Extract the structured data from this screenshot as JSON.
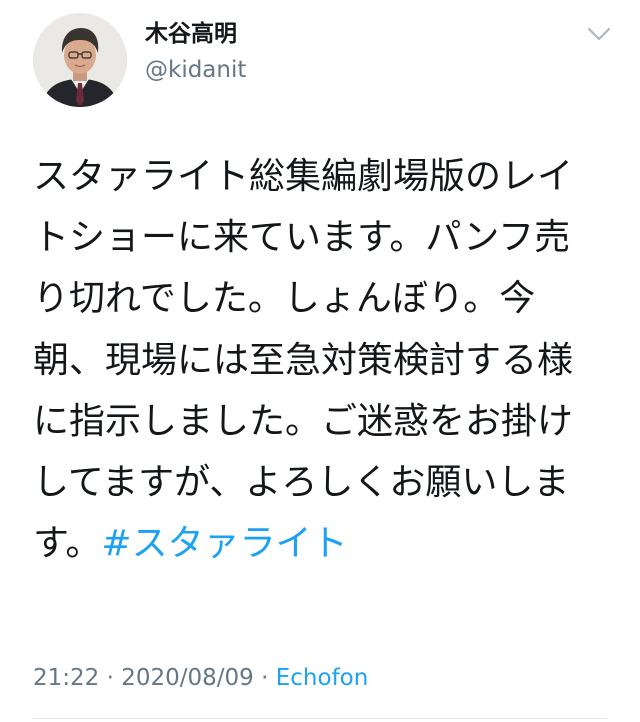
{
  "author": {
    "display_name": "木谷高明",
    "handle": "@kidanit"
  },
  "tweet": {
    "text": "スタァライト総集編劇場版のレイトショーに来ています。パンフ売り切れでした。しょんぼり。今朝、現場には至急対策検討する様に指示しました。ご迷惑をお掛けしてますが、よろしくお願いします。",
    "hashtag": "#スタァライト"
  },
  "meta": {
    "time": "21:22",
    "separator_1": " · ",
    "date": "2020/08/09",
    "separator_2": " · ",
    "source": "Echofon"
  },
  "icons": {
    "menu": "chevron-down-icon",
    "avatar": "profile-photo"
  },
  "colors": {
    "link": "#1da1f2",
    "secondary_text": "#657786",
    "primary_text": "#14171a",
    "divider": "#e1e8ed"
  }
}
